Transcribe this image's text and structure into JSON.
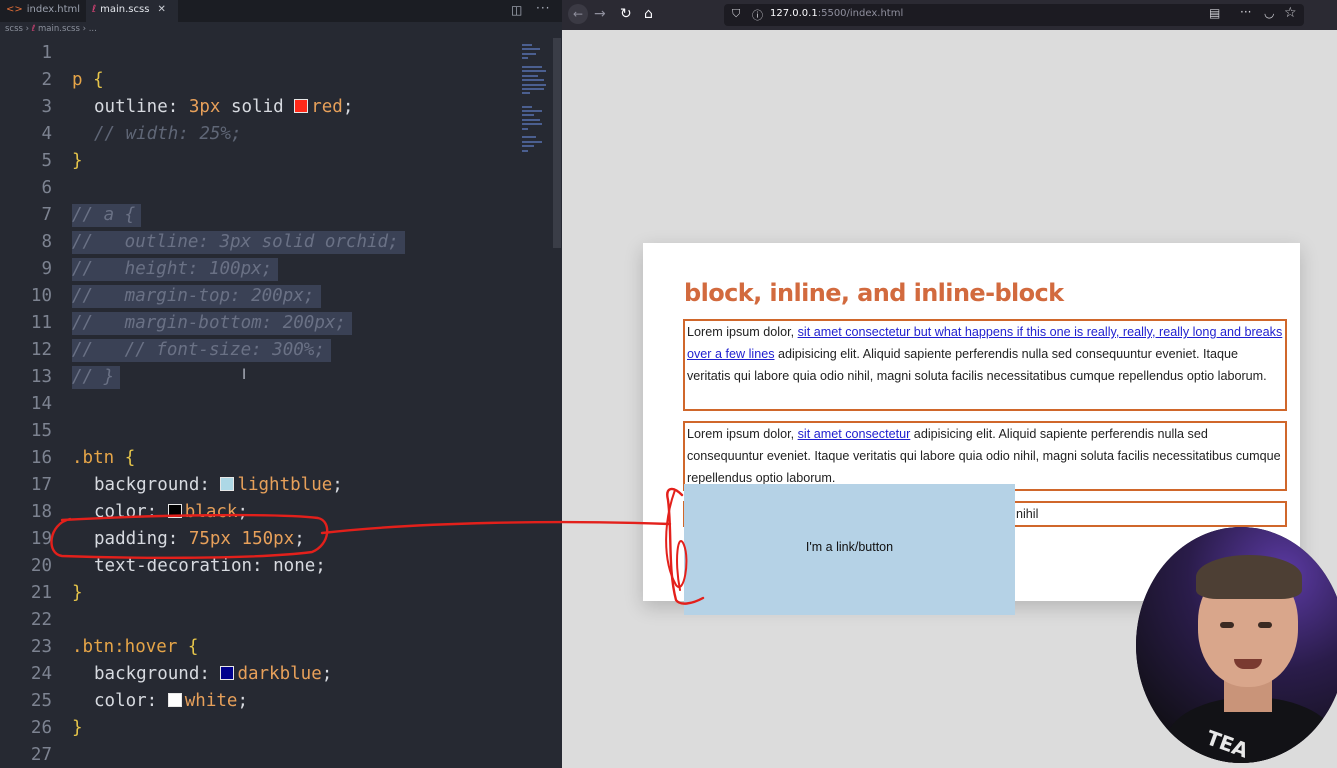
{
  "editor": {
    "tabs": [
      {
        "label": "index.html",
        "icon": "html-file-icon",
        "active": false
      },
      {
        "label": "main.scss",
        "icon": "sass-file-icon",
        "active": true
      }
    ],
    "close_glyph": "✕",
    "breadcrumb": {
      "folder": "scss",
      "file": "main.scss",
      "tail": "..."
    },
    "lines": [
      {
        "n": "1",
        "text": ""
      },
      {
        "n": "2",
        "text": "p {"
      },
      {
        "n": "3",
        "text": "outline: 3px solid red;"
      },
      {
        "n": "4",
        "text": "// width: 25%;"
      },
      {
        "n": "5",
        "text": "}"
      },
      {
        "n": "6",
        "text": ""
      },
      {
        "n": "7",
        "text": "// a {"
      },
      {
        "n": "8",
        "text": "//   outline: 3px solid orchid;"
      },
      {
        "n": "9",
        "text": "//   height: 100px;"
      },
      {
        "n": "10",
        "text": "//   margin-top: 200px;"
      },
      {
        "n": "11",
        "text": "//   margin-bottom: 200px;"
      },
      {
        "n": "12",
        "text": "//   // font-size: 300%;"
      },
      {
        "n": "13",
        "text": "// }"
      },
      {
        "n": "14",
        "text": ""
      },
      {
        "n": "15",
        "text": ""
      },
      {
        "n": "16",
        "text": ".btn {"
      },
      {
        "n": "17",
        "text": "background: lightblue;"
      },
      {
        "n": "18",
        "text": "color: black;"
      },
      {
        "n": "19",
        "text": "padding: 75px 150px;"
      },
      {
        "n": "20",
        "text": "text-decoration: none;"
      },
      {
        "n": "21",
        "text": "}"
      },
      {
        "n": "22",
        "text": ""
      },
      {
        "n": "23",
        "text": ".btn:hover {"
      },
      {
        "n": "24",
        "text": "background: darkblue;"
      },
      {
        "n": "25",
        "text": "color: white;"
      },
      {
        "n": "26",
        "text": "}"
      },
      {
        "n": "27",
        "text": ""
      }
    ],
    "swatch_colors": {
      "red": "#ff2a1a",
      "lightblue": "#add8e6",
      "black": "#000000",
      "darkblue": "#00008b",
      "white": "#ffffff"
    }
  },
  "browser": {
    "url_host": "127.0.0.1",
    "url_rest": ":5500/index.html",
    "page": {
      "heading": "block, inline, and inline-block",
      "para1_start": "Lorem ipsum dolor, ",
      "para1_link": "sit amet consectetur but what happens if this one is really, really, really long and breaks over a few lines",
      "para1_end": " adipisicing elit. Aliquid sapiente perferendis nulla sed consequuntur eveniet. Itaque veritatis qui labore quia odio nihil, magni soluta facilis necessitatibus cumque repellendus optio laborum.",
      "para2_start": "Lorem ipsum dolor, ",
      "para2_link": "sit amet consectetur",
      "para2_end": " adipisicing elit. Aliquid sapiente perferendis nulla sed consequuntur eveniet. Itaque veritatis qui labore quia odio nihil, magni soluta facilis necessitatibus cumque repellendus optio laborum.",
      "para3_text": "nihil",
      "button_label": "I'm a link/button"
    }
  },
  "webcam": {
    "shirt_text": "TEA"
  },
  "colors": {
    "heading": "#d26a3e",
    "outline": "#d0672b",
    "link": "#1f1fcf",
    "button_bg": "#b5d2e6",
    "annotation": "#e3201b"
  }
}
